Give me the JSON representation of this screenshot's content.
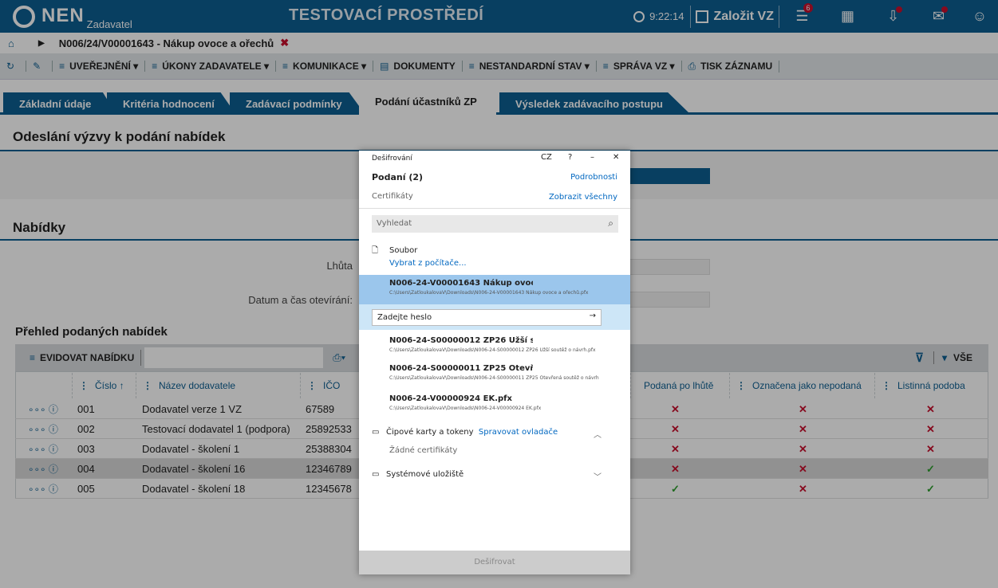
{
  "app": {
    "logo": "NEN",
    "logo_sub": "Zadavatel",
    "environment": "TESTOVACÍ PROSTŘEDÍ",
    "time": "9:22:14",
    "create_label": "Založit VZ",
    "notifications_count": "6"
  },
  "breadcrumb": {
    "title": "N006/24/V00001643 - Nákup ovoce a ořechů"
  },
  "toolbar": [
    "UVEŘEJNĚNÍ ▾",
    "ÚKONY ZADAVATELE ▾",
    "KOMUNIKACE ▾",
    "DOKUMENTY",
    "NESTANDARDNÍ STAV ▾",
    "SPRÁVA VZ ▾",
    "TISK ZÁZNAMU"
  ],
  "tabs": [
    "Základní údaje",
    "Kritéria hodnocení",
    "Zadávací podmínky",
    "Podání účastníků ZP",
    "Výsledek zadávacího postupu"
  ],
  "section1": {
    "title": "Odeslání výzvy k podání nabídek"
  },
  "section2": {
    "title": "Nabídky",
    "lhuta_label": "Lhůta",
    "datum_label": "Datum a čas otevírání:"
  },
  "grid": {
    "title": "Přehled podaných nabídek",
    "evidovat": "EVIDOVAT NABÍDKU",
    "vse": "VŠE",
    "headers": {
      "cislo": "Číslo ↑",
      "nazev": "Název dodavatele",
      "ico": "IČO",
      "podana": "Podaná po lhůtě",
      "oznacena": "Označena jako nepodaná",
      "listinna": "Listinná podoba"
    },
    "rows": [
      {
        "cislo": "001",
        "nazev": "Dodavatel verze 1 VZ",
        "ico": "67589",
        "podana": "✕",
        "oznacena": "✕",
        "listinna": "✕"
      },
      {
        "cislo": "002",
        "nazev": "Testovací dodavatel 1 (podpora)",
        "ico": "25892533",
        "podana": "✕",
        "oznacena": "✕",
        "listinna": "✕"
      },
      {
        "cislo": "003",
        "nazev": "Dodavatel - školení 1",
        "ico": "25388304",
        "podana": "✕",
        "oznacena": "✕",
        "listinna": "✕"
      },
      {
        "cislo": "004",
        "nazev": "Dodavatel - školení 16",
        "ico": "12346789",
        "podana": "✕",
        "oznacena": "✕",
        "listinna": "✓"
      },
      {
        "cislo": "005",
        "nazev": "Dodavatel - školení 18",
        "ico": "12345678",
        "podana": "✓",
        "oznacena": "✕",
        "listinna": "✓"
      }
    ]
  },
  "dialog": {
    "title": "Dešifrování",
    "lang": "CZ",
    "help": "?",
    "minimize": "–",
    "close": "✕",
    "podani": "Podaní   (2)",
    "podrobnosti": "Podrobnosti",
    "certifikaty": "Certifikáty",
    "zobrazit": "Zobrazit všechny",
    "search_placeholder": "Vyhledat",
    "soubor": "Soubor",
    "vybrat": "Vybrat z počítače...",
    "files": [
      {
        "name": "N006-24-V00001643 Nákup ovoc",
        "path": "C:\\Users\\ZatloukalovaV\\Downloads\\N006-24-V00001643 Nákup ovoce a ořechů.pfx"
      },
      {
        "name": "N006-24-S00000012 ZP26 Užší s",
        "path": "C:\\Users\\ZatloukalovaV\\Downloads\\N006-24-S00000012 ZP26 Užší soutěž o návrh.pfx"
      },
      {
        "name": "N006-24-S00000011 ZP25 Otevř",
        "path": "C:\\Users\\ZatloukalovaV\\Downloads\\N006-24-S00000011 ZP25 Otevřená soutěž o návrh"
      },
      {
        "name": "N006-24-V00000924 EK.pfx",
        "path": "C:\\Users\\ZatloukalovaV\\Downloads\\N006-24-V00000924 EK.pfx"
      }
    ],
    "password_placeholder": "Zadejte heslo",
    "cipove": "Čipové karty a tokeny",
    "spravovat": "Spravovat ovladače",
    "zadne": "Žádné certifikáty",
    "systemove": "Systémové uložiště",
    "desifrovat": "Dešifrovat"
  }
}
